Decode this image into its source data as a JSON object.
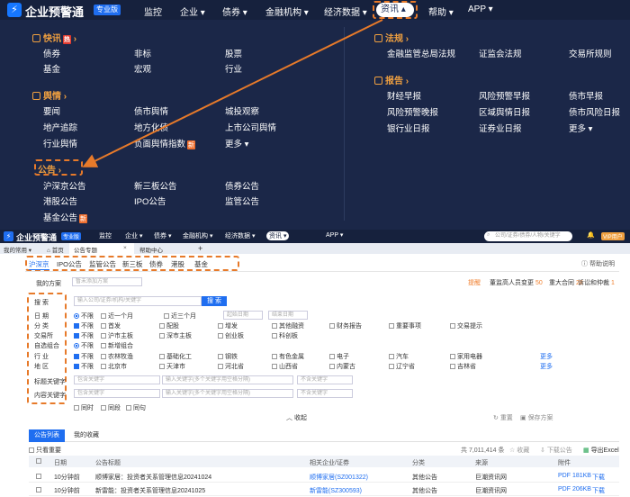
{
  "colors": {
    "nav_bg": "#16213d",
    "menu_bg": "#1b2748",
    "accent": "#1f6ef0",
    "highlight": "#e77a2a",
    "hot": "#e23a2e"
  },
  "top_nav": {
    "logo_icon": "lightning-icon",
    "brand": "企业预警通",
    "badge": "专业版",
    "items": [
      "监控",
      "企业 ▾",
      "债券 ▾",
      "金融机构 ▾",
      "经济数据 ▾",
      "资讯 ▴",
      "帮助 ▾",
      "APP ▾"
    ]
  },
  "mega_menu": {
    "left": [
      {
        "title": "快讯",
        "hot": "热",
        "rows": [
          [
            "债券",
            "非标",
            "股票"
          ],
          [
            "基金",
            "宏观",
            "行业"
          ]
        ]
      },
      {
        "title": "舆情",
        "rows": [
          [
            "要闻",
            "债市舆情",
            "城投观察"
          ],
          [
            "地产追踪",
            "地方化债",
            "上市公司舆情"
          ],
          [
            "行业舆情",
            "负面舆情指数",
            "更多 ▾"
          ]
        ],
        "new_item": "新"
      },
      {
        "title": "公告",
        "rows": [
          [
            "沪深京公告",
            "新三板公告",
            "债券公告"
          ],
          [
            "港股公告",
            "IPO公告",
            "监管公告"
          ],
          [
            "基金公告"
          ]
        ],
        "new_item": "新"
      }
    ],
    "right": [
      {
        "title": "法规",
        "rows": [
          [
            "金融监管总局法规",
            "证监会法规",
            "交易所规则"
          ]
        ]
      },
      {
        "title": "报告",
        "rows": [
          [
            "财经早报",
            "风险预警早报",
            "债市早报"
          ],
          [
            "风险预警晚报",
            "区域舆情日报",
            "债市风险日报"
          ],
          [
            "银行业日报",
            "证券业日报",
            "更多 ▾"
          ]
        ]
      }
    ]
  },
  "app_nav": {
    "brand": "企业预警通",
    "badge": "专业版",
    "items": [
      "监控",
      "企业 ▾",
      "债券 ▾",
      "金融机构 ▾",
      "经济数据 ▾",
      "资讯 ▾",
      "APP ▾"
    ],
    "search_placeholder": "公司/证券/债券/人物/关键字",
    "vip": "VIP用户"
  },
  "tabbar": {
    "my": "我的常用 ▾",
    "home": "首页",
    "active": "公告专题",
    "help": "帮助中心",
    "plus": "+"
  },
  "subnav": {
    "items": [
      "沪深京",
      "IPO公告",
      "监管公告",
      "新三板",
      "债券",
      "港股",
      "基金"
    ],
    "help": "帮助说明"
  },
  "filter": {
    "plan_label": "我的方案",
    "plan_placeholder": "暂未添加方案",
    "stats": [
      {
        "label": "提醒",
        "value": ""
      },
      {
        "label": "董监高人员变更",
        "value": "50"
      },
      {
        "label": "重大合同",
        "value": "28"
      },
      {
        "label": "诉讼和仲裁",
        "value": "1"
      }
    ],
    "search_label": "搜 索",
    "search_placeholder": "输入公司/证券/机构/关键字",
    "search_button": "搜 索",
    "date_label": "日 期",
    "date_options": [
      "不限",
      "近一个月",
      "近三个月"
    ],
    "date_start": "起始日期",
    "date_end": "结束日期",
    "category_label": "分 类",
    "category_options": [
      "不限",
      "首发",
      "配股",
      "增发",
      "其他融资",
      "财务报告",
      "重要事项",
      "交易提示"
    ],
    "exchange_label": "交易所",
    "exchange_options": [
      "不限",
      "沪市主板",
      "深市主板",
      "创业板",
      "科创板"
    ],
    "custom_label": "自选组合",
    "custom_options": [
      "不限",
      "新增组合"
    ],
    "industry_label": "行 业",
    "industry_options": [
      "不限",
      "农林牧渔",
      "基础化工",
      "钢铁",
      "有色金属",
      "电子",
      "汽车",
      "家用电器"
    ],
    "region_label": "地 区",
    "region_options": [
      "不限",
      "北京市",
      "天津市",
      "河北省",
      "山西省",
      "内蒙古",
      "辽宁省",
      "吉林省"
    ],
    "more": "更多",
    "title_kw_label": "标题关键字",
    "content_kw_label": "内容关键字",
    "kw_ph1": "包含关键字",
    "kw_ph2": "输入关键字(多个关键字用空格分隔)",
    "kw_ph3": "不含关键字",
    "sync_options": [
      "同时",
      "同段",
      "同句"
    ],
    "collapse": "收起",
    "reset": "重置",
    "save": "保存方案"
  },
  "results": {
    "tabs": [
      "公告列表",
      "我的收藏"
    ],
    "only_important": "只看重要",
    "total": "共 7,011,414 条",
    "actions": [
      "收藏",
      "下载公告",
      "导出Excel"
    ],
    "headers": [
      "日期",
      "公告标题",
      "相关企业/证券",
      "分类",
      "来源",
      "附件"
    ],
    "rows": [
      {
        "date": "10分钟前",
        "title": "顺博家居：投资者关系管理信息20241024",
        "company": "顺博家居(SZ001322)",
        "category": "其他公告",
        "source": "巨潮资讯网",
        "file": "PDF 181KB",
        "download": "下载"
      },
      {
        "date": "10分钟前",
        "title": "新雷能：投资者关系管理信息20241025",
        "company": "新雷能(SZ300593)",
        "category": "其他公告",
        "source": "巨潮资讯网",
        "file": "PDF 206KB",
        "download": "下载"
      }
    ]
  }
}
